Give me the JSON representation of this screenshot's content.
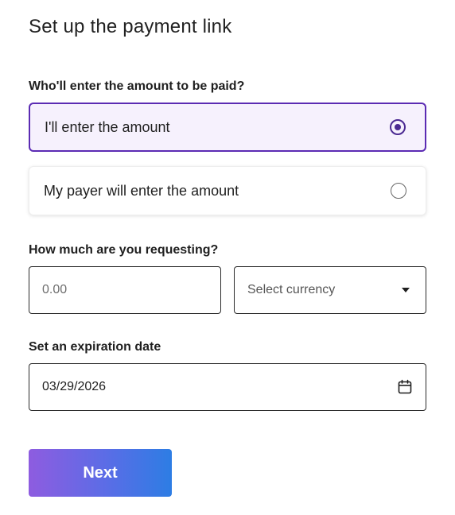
{
  "page": {
    "title": "Set up the payment link"
  },
  "amount_entry": {
    "label": "Who'll enter the amount to be paid?",
    "options": [
      {
        "label": "I'll enter the amount",
        "selected": true
      },
      {
        "label": "My payer will enter the amount",
        "selected": false
      }
    ]
  },
  "request": {
    "label": "How much are you requesting?",
    "amount_placeholder": "0.00",
    "amount_value": "",
    "currency_placeholder": "Select currency"
  },
  "expiration": {
    "label": "Set an expiration date",
    "date_value": "03/29/2026"
  },
  "actions": {
    "next_label": "Next"
  },
  "colors": {
    "accent": "#5b2bb3",
    "selected_bg": "#f6f1fd",
    "button_gradient_start": "#8e5ce0",
    "button_gradient_end": "#2d7de4"
  },
  "icons": {
    "radio_selected": "radio-selected-icon",
    "radio_unselected": "radio-unselected-icon",
    "dropdown": "chevron-down-icon",
    "calendar": "calendar-icon"
  }
}
